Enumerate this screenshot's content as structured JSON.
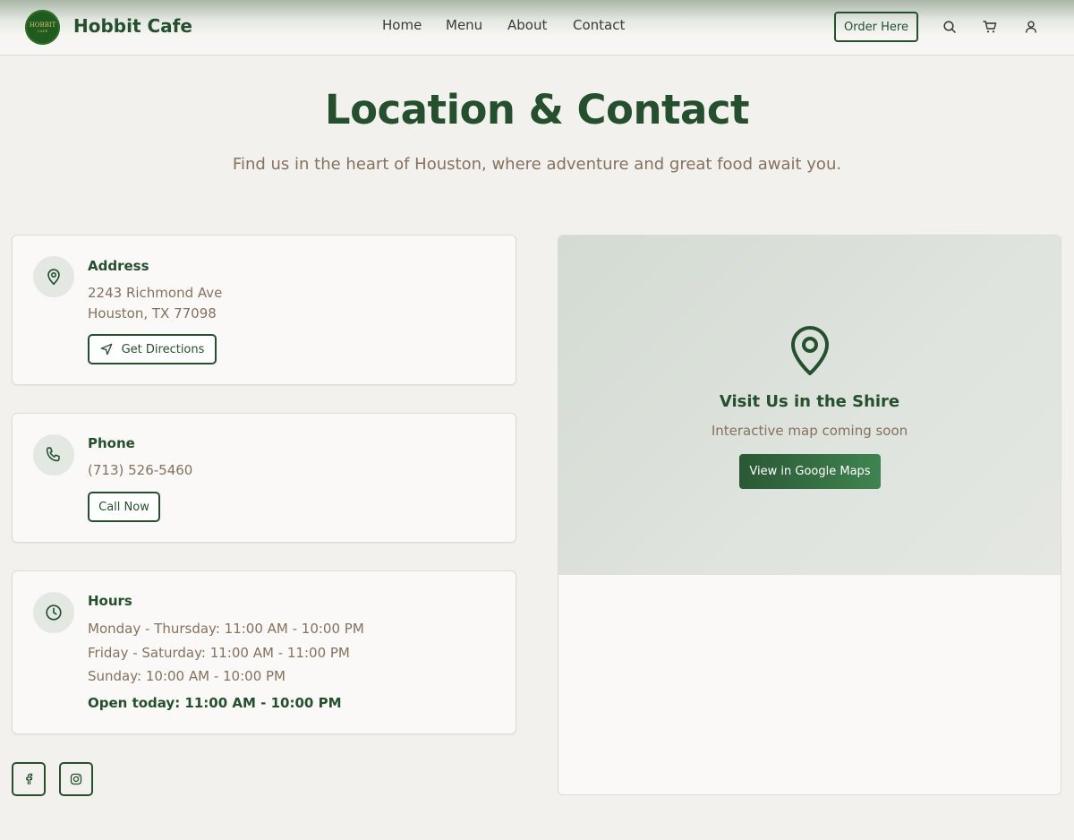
{
  "header": {
    "logo_text": "HOBBIT",
    "logo_sub": "CAFE",
    "brand": "Hobbit Cafe",
    "nav": [
      "Home",
      "Menu",
      "About",
      "Contact"
    ],
    "order_label": "Order Here",
    "icons": [
      "search-icon",
      "cart-icon",
      "user-icon"
    ]
  },
  "hero": {
    "title": "Location & Contact",
    "subtitle": "Find us in the heart of Houston, where adventure and great food await you."
  },
  "address": {
    "title": "Address",
    "line1": "2243 Richmond Ave",
    "line2": "Houston, TX 77098",
    "button": "Get Directions"
  },
  "phone": {
    "title": "Phone",
    "number": "(713) 526-5460",
    "button": "Call Now"
  },
  "hours": {
    "title": "Hours",
    "weekday": "Monday - Thursday: 11:00 AM - 10:00 PM",
    "weekend": "Friday - Saturday: 11:00 AM - 11:00 PM",
    "sunday": "Sunday: 10:00 AM - 10:00 PM",
    "today": "Open today: 11:00 AM - 10:00 PM"
  },
  "social": [
    "facebook-icon",
    "instagram-icon"
  ],
  "map": {
    "title": "Visit Us in the Shire",
    "note": "Interactive map coming soon",
    "button": "View in Google Maps"
  },
  "colors": {
    "primary": "#24502d",
    "muted_text": "#85715e",
    "background": "#f3f1ed",
    "card": "#faf9f7"
  }
}
